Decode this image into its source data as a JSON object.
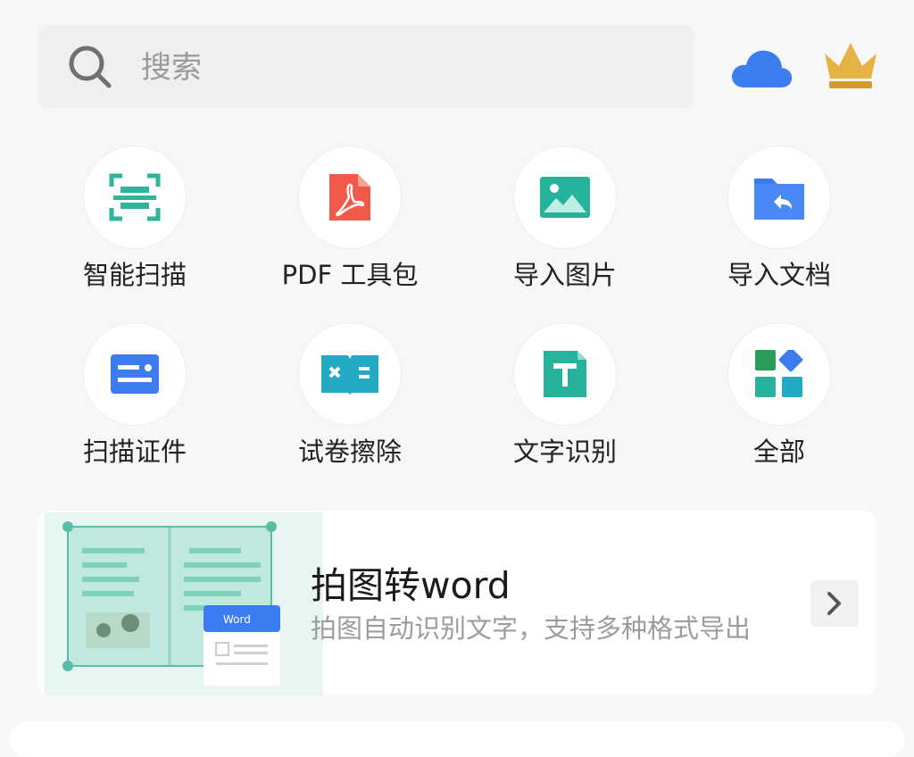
{
  "search": {
    "placeholder": "搜索"
  },
  "header_icons": [
    "cloud-icon",
    "crown-icon"
  ],
  "tools": [
    {
      "label": "智能扫描",
      "icon": "smart-scan-icon",
      "color": "#2fb59b"
    },
    {
      "label": "PDF 工具包",
      "icon": "pdf-icon",
      "color": "#f15a4a"
    },
    {
      "label": "导入图片",
      "icon": "image-icon",
      "color": "#25b39b"
    },
    {
      "label": "导入文档",
      "icon": "folder-import-icon",
      "color": "#3b7cf0"
    },
    {
      "label": "扫描证件",
      "icon": "id-card-icon",
      "color": "#3b7cf0"
    },
    {
      "label": "试卷擦除",
      "icon": "exam-erase-icon",
      "color": "#22a9c4"
    },
    {
      "label": "文字识别",
      "icon": "text-ocr-icon",
      "color": "#25b39b"
    },
    {
      "label": "全部",
      "icon": "all-apps-icon",
      "color": "#3b7cf0"
    }
  ],
  "banner": {
    "title": "拍图转word",
    "subtitle": "拍图自动识别文字，支持多种格式导出",
    "doc_badge": "Word"
  },
  "colors": {
    "accent_green": "#25b39b",
    "accent_blue": "#3b7cf0",
    "crown_gold": "#e2ad3f"
  }
}
